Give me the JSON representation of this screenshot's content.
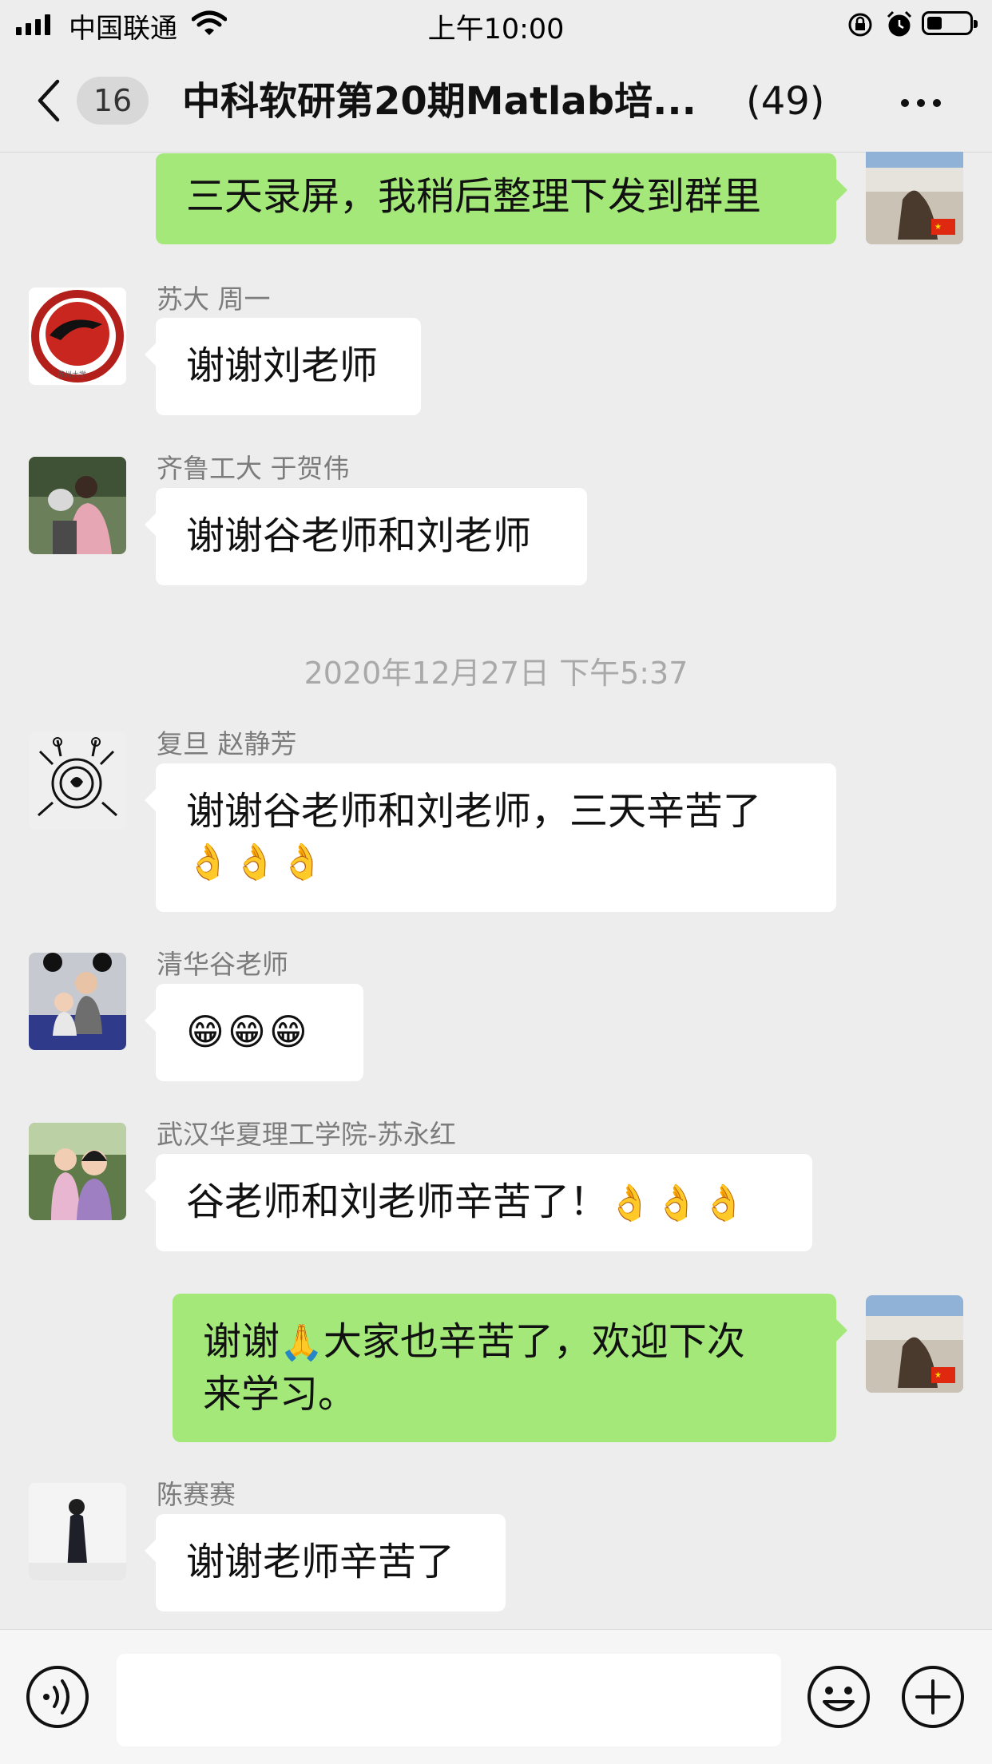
{
  "status_bar": {
    "carrier": "中国联通",
    "time": "上午10:00"
  },
  "nav": {
    "back_icon": "chevron-left-icon",
    "unread_count": "16",
    "title": "中科软研第20期Matlab培...",
    "member_count": "(49)",
    "more_icon": "more-dots-icon"
  },
  "messages": [
    {
      "side": "out",
      "text": "三天录屏，我稍后整理下发到群里"
    },
    {
      "side": "in",
      "sender": "苏大 周一",
      "text": "谢谢刘老师"
    },
    {
      "side": "in",
      "sender": "齐鲁工大 于贺伟",
      "text": "谢谢谷老师和刘老师"
    },
    {
      "side": "in",
      "sender": "复旦 赵静芳",
      "text_line1": "谢谢谷老师和刘老师，三天辛苦了",
      "emojis": "👌👌👌"
    },
    {
      "side": "in",
      "sender": "清华谷老师",
      "emojis": "😁😁😁"
    },
    {
      "side": "in",
      "sender": "武汉华夏理工学院-苏永红",
      "text": "谷老师和刘老师辛苦了！",
      "emojis": "👌👌👌"
    },
    {
      "side": "out",
      "text_a": "谢谢",
      "emoji": "🙏",
      "text_b": "大家也辛苦了，欢迎下次",
      "text_line2": "来学习。"
    },
    {
      "side": "in",
      "sender": "陈赛赛",
      "text": "谢谢老师辛苦了"
    }
  ],
  "timestamp": "2020年12月27日 下午5:37",
  "colors": {
    "background": "#ededed",
    "bubble_out": "#a4e87a",
    "bubble_in": "#ffffff"
  },
  "input_bar": {
    "voice_icon": "voice-icon",
    "emoji_icon": "emoji-face-icon",
    "plus_icon": "plus-circle-icon"
  }
}
